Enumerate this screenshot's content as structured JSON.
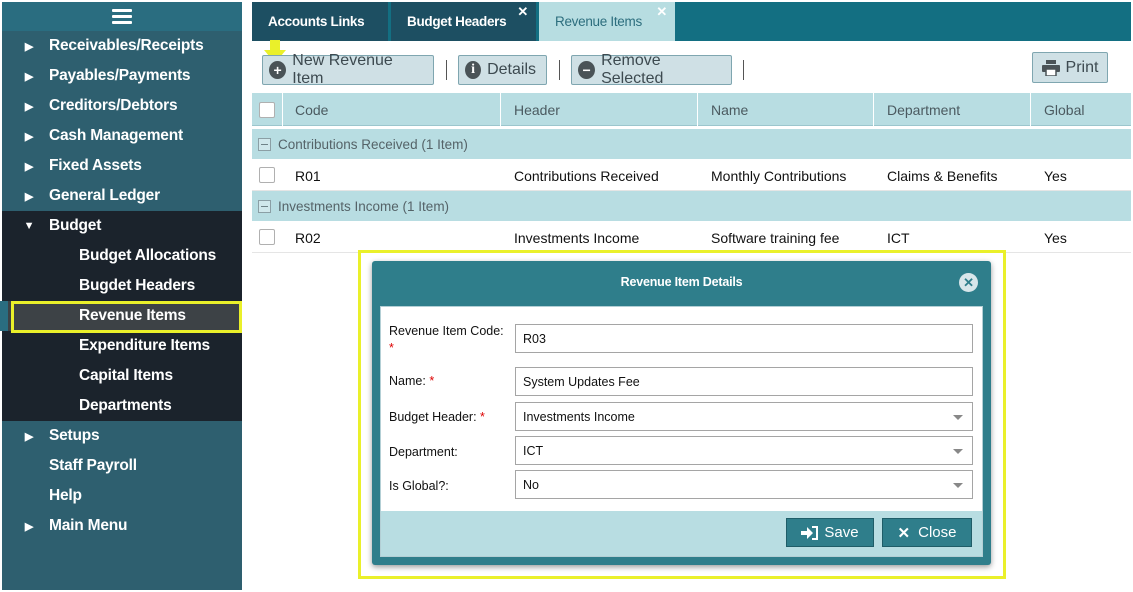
{
  "sidebar": {
    "items": [
      {
        "label": "Receivables/Receipts",
        "arrow": "▶"
      },
      {
        "label": "Payables/Payments",
        "arrow": "▶"
      },
      {
        "label": "Creditors/Debtors",
        "arrow": "▶"
      },
      {
        "label": "Cash Management",
        "arrow": "▶"
      },
      {
        "label": "Fixed Assets",
        "arrow": "▶"
      },
      {
        "label": "General Ledger",
        "arrow": "▶"
      }
    ],
    "budget": {
      "label": "Budget",
      "arrow": "▼"
    },
    "budget_sub": [
      "Budget Allocations",
      "Bugdet Headers",
      "Revenue Items",
      "Expenditure Items",
      "Capital Items",
      "Departments"
    ],
    "after": [
      {
        "label": "Setups",
        "arrow": "▶"
      },
      {
        "label": "Staff Payroll",
        "arrow": ""
      },
      {
        "label": "Help",
        "arrow": ""
      },
      {
        "label": "Main Menu",
        "arrow": "▶"
      }
    ]
  },
  "tabs": [
    {
      "label": "Accounts Links"
    },
    {
      "label": "Budget Headers",
      "close": "✕"
    },
    {
      "label": "Revenue Items",
      "close": "✕"
    }
  ],
  "toolbar": {
    "new_label": "New Revenue Item",
    "details_label": "Details",
    "remove_label": "Remove Selected",
    "print_label": "Print"
  },
  "table": {
    "columns": [
      "Code",
      "Header",
      "Name",
      "Department",
      "Global"
    ],
    "groups": [
      {
        "title": "Contributions Received (1 Item)",
        "rows": [
          {
            "code": "R01",
            "header": "Contributions Received",
            "name": "Monthly Contributions",
            "department": "Claims & Benefits",
            "global": "Yes"
          }
        ]
      },
      {
        "title": "Investments Income (1 Item)",
        "rows": [
          {
            "code": "R02",
            "header": "Investments Income",
            "name": "Software training fee",
            "department": "ICT",
            "global": "Yes"
          }
        ]
      }
    ]
  },
  "dialog": {
    "title": "Revenue Item Details",
    "fields": {
      "code_label": "Revenue Item Code:",
      "code_value": "R03",
      "name_label": "Name:",
      "name_value": "System Updates Fee",
      "header_label": "Budget Header:",
      "header_value": "Investments Income",
      "dept_label": "Department:",
      "dept_value": "ICT",
      "global_label": "Is Global?:",
      "global_value": "No",
      "required_mark": "*"
    },
    "save_label": "Save",
    "close_label": "Close"
  },
  "colors": {
    "sidebar_bg": "#2e5f6f",
    "sidebar_sub_bg": "#1b232c",
    "tabbar_bg": "#136f82",
    "accent": "#2f7e8b",
    "highlight": "#eaf02a"
  }
}
